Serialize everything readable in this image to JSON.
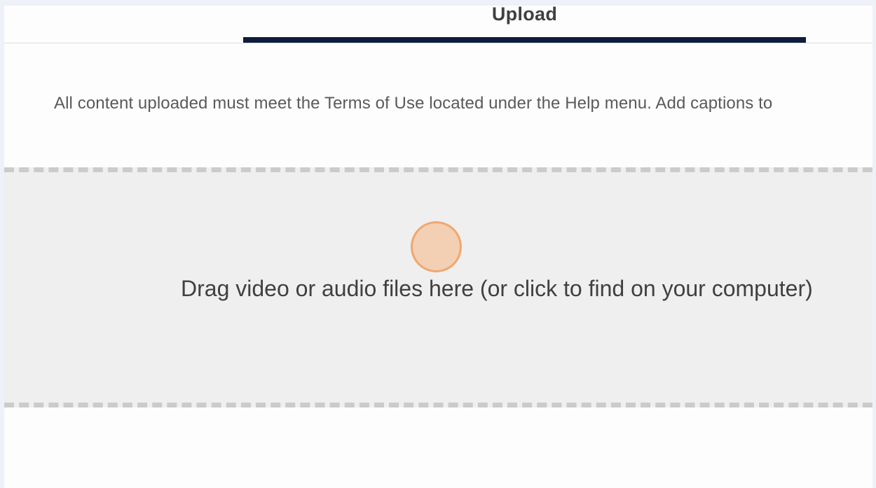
{
  "tabs": {
    "active_label": "Upload"
  },
  "notice": {
    "text": "All content uploaded must meet the Terms of Use located under the Help menu. Add captions to"
  },
  "dropzone": {
    "label": "Drag video or audio files here (or click to find on your computer)"
  },
  "colors": {
    "tab_indicator": "#0d1d3d",
    "dropzone_bg": "#efefef",
    "dropzone_border": "#cbcbcb",
    "cursor_highlight": "#f5b482"
  }
}
